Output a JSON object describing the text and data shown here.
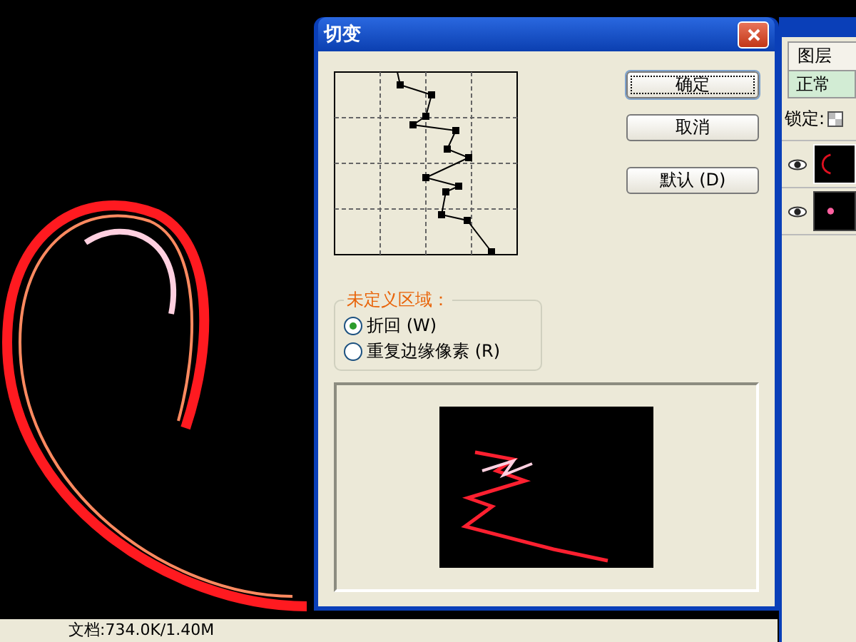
{
  "dialog": {
    "title": "切变",
    "buttons": [
      {
        "label": "确定",
        "default": true
      },
      {
        "label": "取消",
        "default": false
      },
      {
        "label": "默认 (D)",
        "default": false
      }
    ],
    "undefined_area": {
      "label": "未定义区域：",
      "options": [
        {
          "label": "折回 (W)",
          "selected": true
        },
        {
          "label": "重复边缘像素 (R)",
          "selected": false
        }
      ]
    }
  },
  "layers_panel": {
    "tab": "图层",
    "blend_mode": "正常",
    "lock_label": "锁定:",
    "layers": [
      {
        "visible": true,
        "selected": true
      },
      {
        "visible": true,
        "selected": false
      }
    ]
  },
  "status_bar": {
    "document": "文档:734.0K/1.40M"
  }
}
